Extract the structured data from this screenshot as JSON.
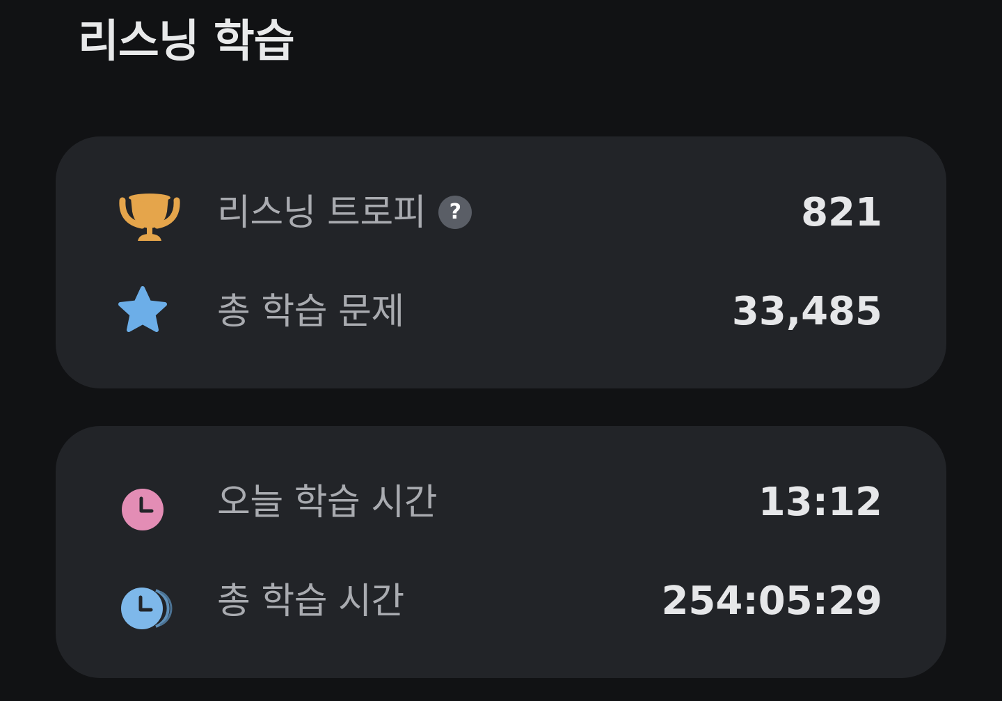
{
  "header": {
    "title": "리스닝 학습"
  },
  "cards": [
    {
      "rows": [
        {
          "icon": "trophy-icon",
          "icon_color": "#E5A54B",
          "label": "리스닝 트로피",
          "help": "?",
          "value": "821"
        },
        {
          "icon": "star-icon",
          "icon_color": "#6CAEE8",
          "label": "총 학습 문제",
          "value": "33,485"
        }
      ]
    },
    {
      "rows": [
        {
          "icon": "clock-icon",
          "icon_color": "#E38DB5",
          "label": "오늘 학습 시간",
          "value": "13:12"
        },
        {
          "icon": "fast-clock-icon",
          "icon_color": "#7EB8EA",
          "label": "총 학습 시간",
          "value": "254:05:29"
        }
      ]
    }
  ],
  "colors": {
    "background": "#111214",
    "card": "#222428",
    "label": "#A9ABB0",
    "value": "#E6E7E9"
  }
}
